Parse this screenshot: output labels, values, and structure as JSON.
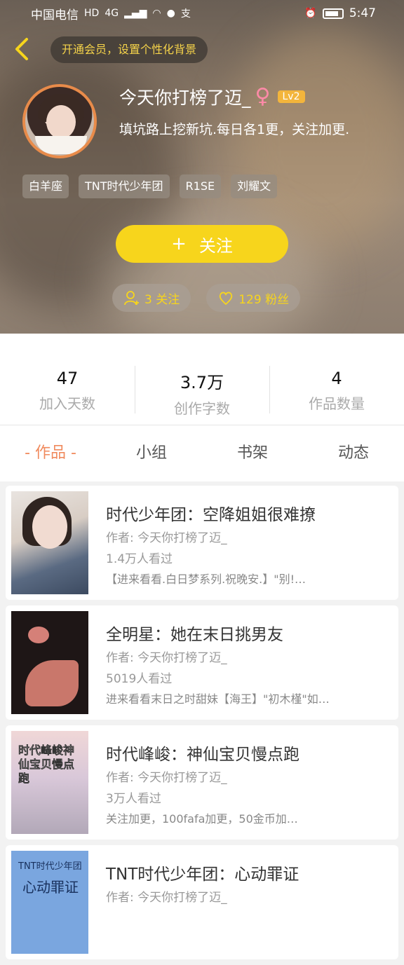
{
  "status_bar": {
    "carrier": "中国电信",
    "time": "5:47",
    "hd": "HD",
    "network": "4G"
  },
  "header": {
    "member_prompt": "开通会员，设置个性化背景",
    "username": "今天你打榜了迈_",
    "gender_symbol": "♀",
    "level": "Lv2",
    "bio": "填坑路上挖新坑.每日各1更，关注加更.",
    "tags": [
      "白羊座",
      "TNT时代少年团",
      "R1SE",
      "刘耀文"
    ],
    "follow_button": {
      "plus": "+",
      "label": "关注"
    },
    "following": "3 关注",
    "fans": "129 粉丝"
  },
  "stats": [
    {
      "value": "47",
      "label": "加入天数"
    },
    {
      "value": "3.7万",
      "label": "创作字数"
    },
    {
      "value": "4",
      "label": "作品数量"
    }
  ],
  "tabs": [
    "- 作品 -",
    "小组",
    "书架",
    "动态"
  ],
  "books": [
    {
      "title": "时代少年团：空降姐姐很难撩",
      "author": "作者: 今天你打榜了迈_",
      "views": "1.4万人看过",
      "desc": "【进来看看.白日梦系列.祝晚安.】\"别!…"
    },
    {
      "title": "全明星：她在末日挑男友",
      "author": "作者: 今天你打榜了迈_",
      "views": "5019人看过",
      "desc": "进来看看末日之时甜妹【海王】\"初木槿\"如…"
    },
    {
      "title": "时代峰峻：神仙宝贝慢点跑",
      "author": "作者: 今天你打榜了迈_",
      "views": "3万人看过",
      "desc": "关注加更，100fafa加更，50金币加…",
      "cover_text": "时代峰峻神仙宝贝慢点跑"
    },
    {
      "title": "TNT时代少年团：心动罪证",
      "author": "作者: 今天你打榜了迈_",
      "cover_text_top": "TNT时代少年团",
      "cover_text_main": "心动罪证"
    }
  ],
  "colors": {
    "accent": "#f7d51c",
    "tab_active": "#f08a5d",
    "avatar_ring": "#e88b4a",
    "level_badge": "#f3b53c"
  }
}
